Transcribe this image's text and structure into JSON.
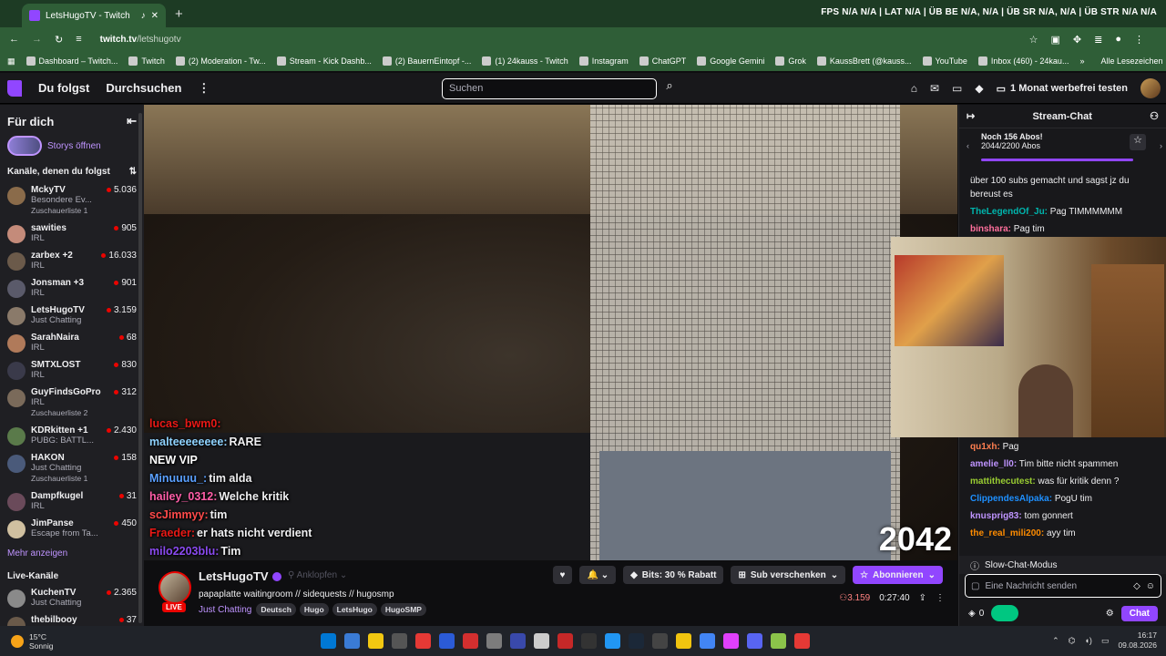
{
  "browser": {
    "tab_title": "LetsHugoTV - Twitch",
    "url_host": "twitch.tv",
    "url_path": "/letshugotv",
    "stats": "FPS N/A N/A  |  LAT N/A  |  ÜB BE N/A, N/A  |  ÜB SR N/A, N/A  |  ÜB STR N/A N/A",
    "bookmarks": [
      "Dashboard – Twitch...",
      "Twitch",
      "(2) Moderation - Tw...",
      "Stream - Kick Dashb...",
      "(2) BauernEintopf -...",
      "(1) 24kauss - Twitch",
      "Instagram",
      "ChatGPT",
      "Google Gemini",
      "Grok",
      "KaussBrett (@kauss...",
      "YouTube",
      "Inbox (460) - 24kau..."
    ],
    "bookmarks_all": "Alle Lesezeichen"
  },
  "twitch_nav": {
    "following": "Du folgst",
    "browse": "Durchsuchen",
    "search_placeholder": "Suchen",
    "promo": "1 Monat werbefrei testen"
  },
  "sidebar": {
    "for_you": "Für dich",
    "stories": "Storys öffnen",
    "followed_header": "Kanäle, denen du folgst",
    "channels": [
      {
        "name": "MckyTV",
        "game": "Besondere Ev...",
        "viewers": "5.036",
        "sub": "Zuschauerliste 1",
        "color": "#8a6b4a"
      },
      {
        "name": "sawities",
        "game": "IRL",
        "viewers": "905",
        "sub": "",
        "color": "#c48b7a"
      },
      {
        "name": "zarbex +2",
        "game": "IRL",
        "viewers": "16.033",
        "sub": "",
        "color": "#6b5a4a"
      },
      {
        "name": "Jonsman +3",
        "game": "IRL",
        "viewers": "901",
        "sub": "",
        "color": "#5a5a6a"
      },
      {
        "name": "LetsHugoTV",
        "game": "Just Chatting",
        "viewers": "3.159",
        "sub": "",
        "color": "#8a7a6a"
      },
      {
        "name": "SarahNaira",
        "game": "IRL",
        "viewers": "68",
        "sub": "",
        "color": "#b07a5a"
      },
      {
        "name": "SMTXLOST",
        "game": "IRL",
        "viewers": "830",
        "sub": "",
        "color": "#3a3a4a"
      },
      {
        "name": "GuyFindsGoPro",
        "game": "IRL",
        "viewers": "312",
        "sub": "Zuschauerliste 2",
        "color": "#7a6a5a"
      },
      {
        "name": "KDRkitten +1",
        "game": "PUBG: BATTL...",
        "viewers": "2.430",
        "sub": "",
        "color": "#5a7a4a"
      },
      {
        "name": "HAKON",
        "game": "Just Chatting",
        "viewers": "158",
        "sub": "Zuschauerliste 1",
        "color": "#4a5a7a"
      },
      {
        "name": "Dampfkugel",
        "game": "IRL",
        "viewers": "31",
        "sub": "",
        "color": "#6a4a5a"
      },
      {
        "name": "JimPanse",
        "game": "Escape from Ta...",
        "viewers": "450",
        "sub": "",
        "color": "#d0c0a0"
      }
    ],
    "show_more": "Mehr anzeigen",
    "live_header": "Live-Kanäle",
    "live_channels": [
      {
        "name": "KuchenTV",
        "game": "Just Chatting",
        "viewers": "2.365",
        "color": "#8a8a8a"
      },
      {
        "name": "thebilbooy",
        "game": "",
        "viewers": "37",
        "color": "#6a5a4a"
      }
    ]
  },
  "overlay_chat": [
    {
      "user": "lucas_bwm0:",
      "text": "",
      "color": "#e91916"
    },
    {
      "user": "malteeeeeeee:",
      "text": "RARE",
      "color": "#8fd3ff"
    },
    {
      "user": "",
      "text": "NEW VIP",
      "color": "#ffffff"
    },
    {
      "user": "Minuuuu_:",
      "text": "tim alda",
      "color": "#5aa0ff"
    },
    {
      "user": "hailey_0312:",
      "text": "Welche kritik",
      "color": "#ff5ea8"
    },
    {
      "user": "scJimmyy:",
      "text": "tim",
      "color": "#ff4a4a"
    },
    {
      "user": "Fraeder:",
      "text": "er hats nicht verdient",
      "color": "#e91916"
    },
    {
      "user": "milo2203blu:",
      "text": "Tim",
      "color": "#8a4af0"
    }
  ],
  "viewer_counter_overlay": "2042",
  "stream": {
    "channel": "LetsHugoTV",
    "pin": "Anklopfen",
    "live": "LIVE",
    "title": "papaplatte waitingroom // sidequests // hugosmp",
    "category": "Just Chatting",
    "tags": [
      "Deutsch",
      "Hugo",
      "LetsHugo",
      "HugoSMP"
    ],
    "bits": "Bits: 30 % Rabatt",
    "gift": "Sub verschenken",
    "subscribe": "Abonnieren",
    "viewers": "3.159",
    "uptime": "0:27:40"
  },
  "chat": {
    "title": "Stream-Chat",
    "goal_title": "Noch 156 Abos!",
    "goal_progress": "2044/2200 Abos",
    "goal_fraction": 0.929,
    "messages_top": [
      {
        "user": "",
        "text": "über 100 subs gemacht und sagst jz du bereust es",
        "color": "#ffffff"
      },
      {
        "user": "TheLegendOf_Ju:",
        "text": "Pag TIMMMMMM",
        "color": "#00b5ad"
      },
      {
        "user": "binshara:",
        "text": "Pag tim",
        "color": "#ff6f9c"
      }
    ],
    "messages_bottom": [
      {
        "user": "qu1xh:",
        "text": "Pag",
        "color": "#ff7f50"
      },
      {
        "user": "amelie_ll0:",
        "text": "Tim bitte nicht spammen",
        "color": "#bf94ff"
      },
      {
        "user": "mattithecutest:",
        "text": "was für kritik denn ?",
        "color": "#9acd32"
      },
      {
        "user": "ClippendesAlpaka:",
        "text": "PogU tim",
        "color": "#1e90ff"
      },
      {
        "user": "knusprig83:",
        "text": "tom gonnert",
        "color": "#bf94ff"
      },
      {
        "user": "the_real_mili200:",
        "text": "ayy tim",
        "color": "#ff8c00"
      }
    ],
    "slow_mode": "Slow-Chat-Modus",
    "input_placeholder": "Eine Nachricht senden",
    "points": "0",
    "send": "Chat"
  },
  "taskbar": {
    "temp": "15°C",
    "weather": "Sonnig",
    "time": "16:17",
    "date": "09.08.2026",
    "app_colors": [
      "#0078d4",
      "#3a7bd5",
      "#f2c811",
      "#555",
      "#e53935",
      "#2b5bd7",
      "#d32f2f",
      "#7c7c7c",
      "#3949ab",
      "#ccc",
      "#c62828",
      "#333",
      "#2196f3",
      "#1b2838",
      "#444",
      "#f1c40f",
      "#4285f4",
      "#e040fb",
      "#5865f2",
      "#8bc34a",
      "#e53935"
    ]
  }
}
